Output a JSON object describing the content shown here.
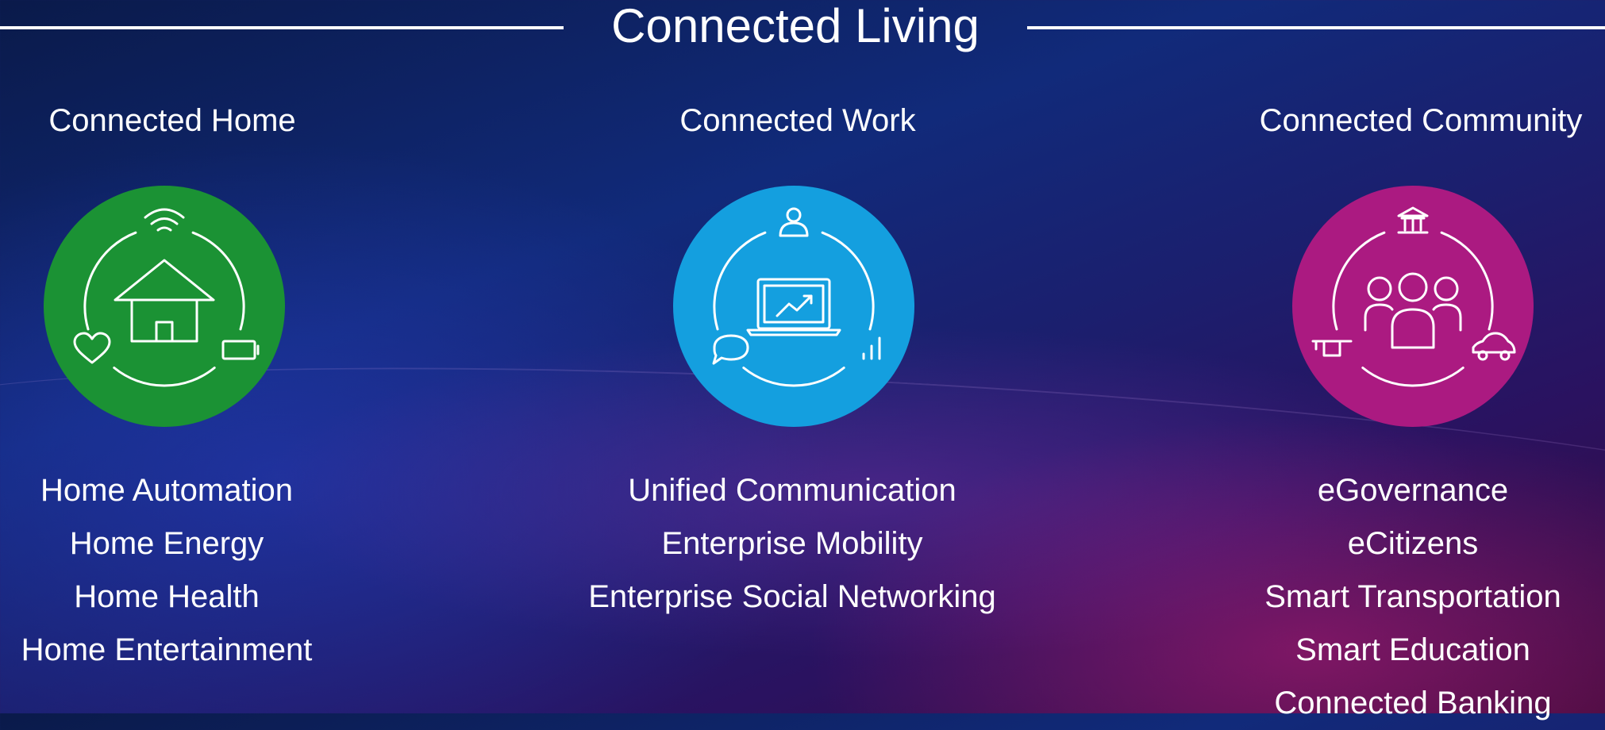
{
  "title": "Connected Living",
  "colors": {
    "home": "#1b9234",
    "work": "#149fdf",
    "community": "#ab1a81"
  },
  "columns": [
    {
      "title": "Connected Home",
      "icons": [
        "wifi-icon",
        "house-icon",
        "heart-icon",
        "battery-icon"
      ],
      "items": [
        "Home Automation",
        "Home Energy",
        "Home Health",
        "Home Entertainment"
      ]
    },
    {
      "title": "Connected Work",
      "icons": [
        "person-icon",
        "laptop-chart-icon",
        "chat-bubble-icon",
        "signal-bars-icon"
      ],
      "items": [
        "Unified Communication",
        "Enterprise Mobility",
        "Enterprise Social Networking"
      ]
    },
    {
      "title": "Connected Community",
      "icons": [
        "government-building-icon",
        "people-group-icon",
        "graduation-cap-icon",
        "car-icon"
      ],
      "items": [
        "eGovernance",
        "eCitizens",
        "Smart Transportation",
        "Smart Education",
        "Connected Banking"
      ]
    }
  ]
}
